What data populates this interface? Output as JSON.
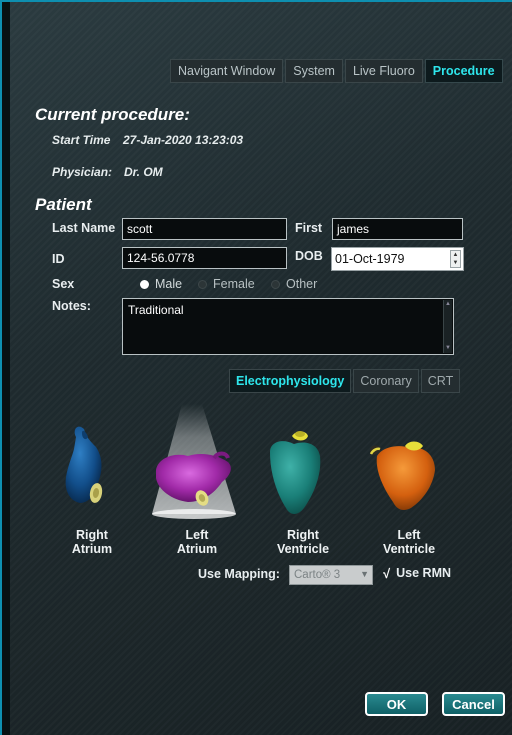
{
  "tabs": [
    {
      "label": "Navigant Window"
    },
    {
      "label": "System"
    },
    {
      "label": "Live Fluoro"
    },
    {
      "label": "Procedure",
      "active": true
    }
  ],
  "current_procedure": {
    "heading": "Current procedure:",
    "start_time_label": "Start Time",
    "start_time_value": "27-Jan-2020 13:23:03",
    "physician_label": "Physician:",
    "physician_value": "Dr. OM"
  },
  "patient": {
    "heading": "Patient",
    "last_name_label": "Last Name",
    "last_name_value": "scott",
    "first_label": "First",
    "first_value": "james",
    "id_label": "ID",
    "id_value": "124-56.0778",
    "dob_label": "DOB",
    "dob_value": "01-Oct-1979",
    "sex_label": "Sex",
    "sex_options": [
      "Male",
      "Female",
      "Other"
    ],
    "sex_selected": "Male",
    "notes_label": "Notes:",
    "notes_value": "Traditional"
  },
  "subtabs": [
    {
      "label": "Electrophysiology",
      "active": true
    },
    {
      "label": "Coronary"
    },
    {
      "label": "CRT"
    }
  ],
  "anatomy": [
    {
      "label_line1": "Right",
      "label_line2": "Atrium",
      "icon": "right-atrium-icon"
    },
    {
      "label_line1": "Left",
      "label_line2": "Atrium",
      "icon": "left-atrium-icon",
      "selected": true
    },
    {
      "label_line1": "Right",
      "label_line2": "Ventricle",
      "icon": "right-ventricle-icon"
    },
    {
      "label_line1": "Left",
      "label_line2": "Ventricle",
      "icon": "left-ventricle-icon"
    }
  ],
  "mapping": {
    "label": "Use Mapping:",
    "value": "Carto® 3",
    "use_rmn_label": "Use RMN",
    "use_rmn_checked": true
  },
  "buttons": {
    "ok": "OK",
    "cancel": "Cancel"
  },
  "colors": {
    "accent": "#2ee6ec",
    "button": "#0f6167",
    "border": "#0e8fb0"
  }
}
